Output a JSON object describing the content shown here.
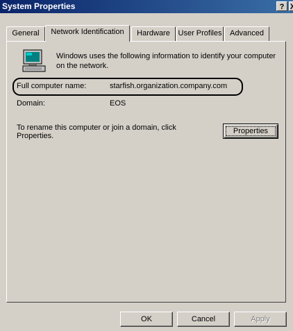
{
  "window": {
    "title": "System Properties",
    "help_glyph": "?",
    "close_glyph": "X"
  },
  "tabs": [
    {
      "label": "General"
    },
    {
      "label": "Network Identification",
      "active": true
    },
    {
      "label": "Hardware"
    },
    {
      "label": "User Profiles"
    },
    {
      "label": "Advanced"
    }
  ],
  "content": {
    "description": "Windows uses the following information to identify your computer on the network.",
    "full_name_label": "Full computer name:",
    "full_name_value": "starfish.organization.company.com",
    "domain_label": "Domain:",
    "domain_value": "EOS",
    "rename_text": "To rename this computer or join a domain, click Properties.",
    "properties_button": "Properties"
  },
  "footer": {
    "ok": "OK",
    "cancel": "Cancel",
    "apply": "Apply"
  },
  "colors": {
    "titlebar_start": "#0a246a",
    "titlebar_end": "#3a6ea5",
    "face": "#d4d0c8"
  },
  "icons": {
    "computer": "computer-icon"
  }
}
